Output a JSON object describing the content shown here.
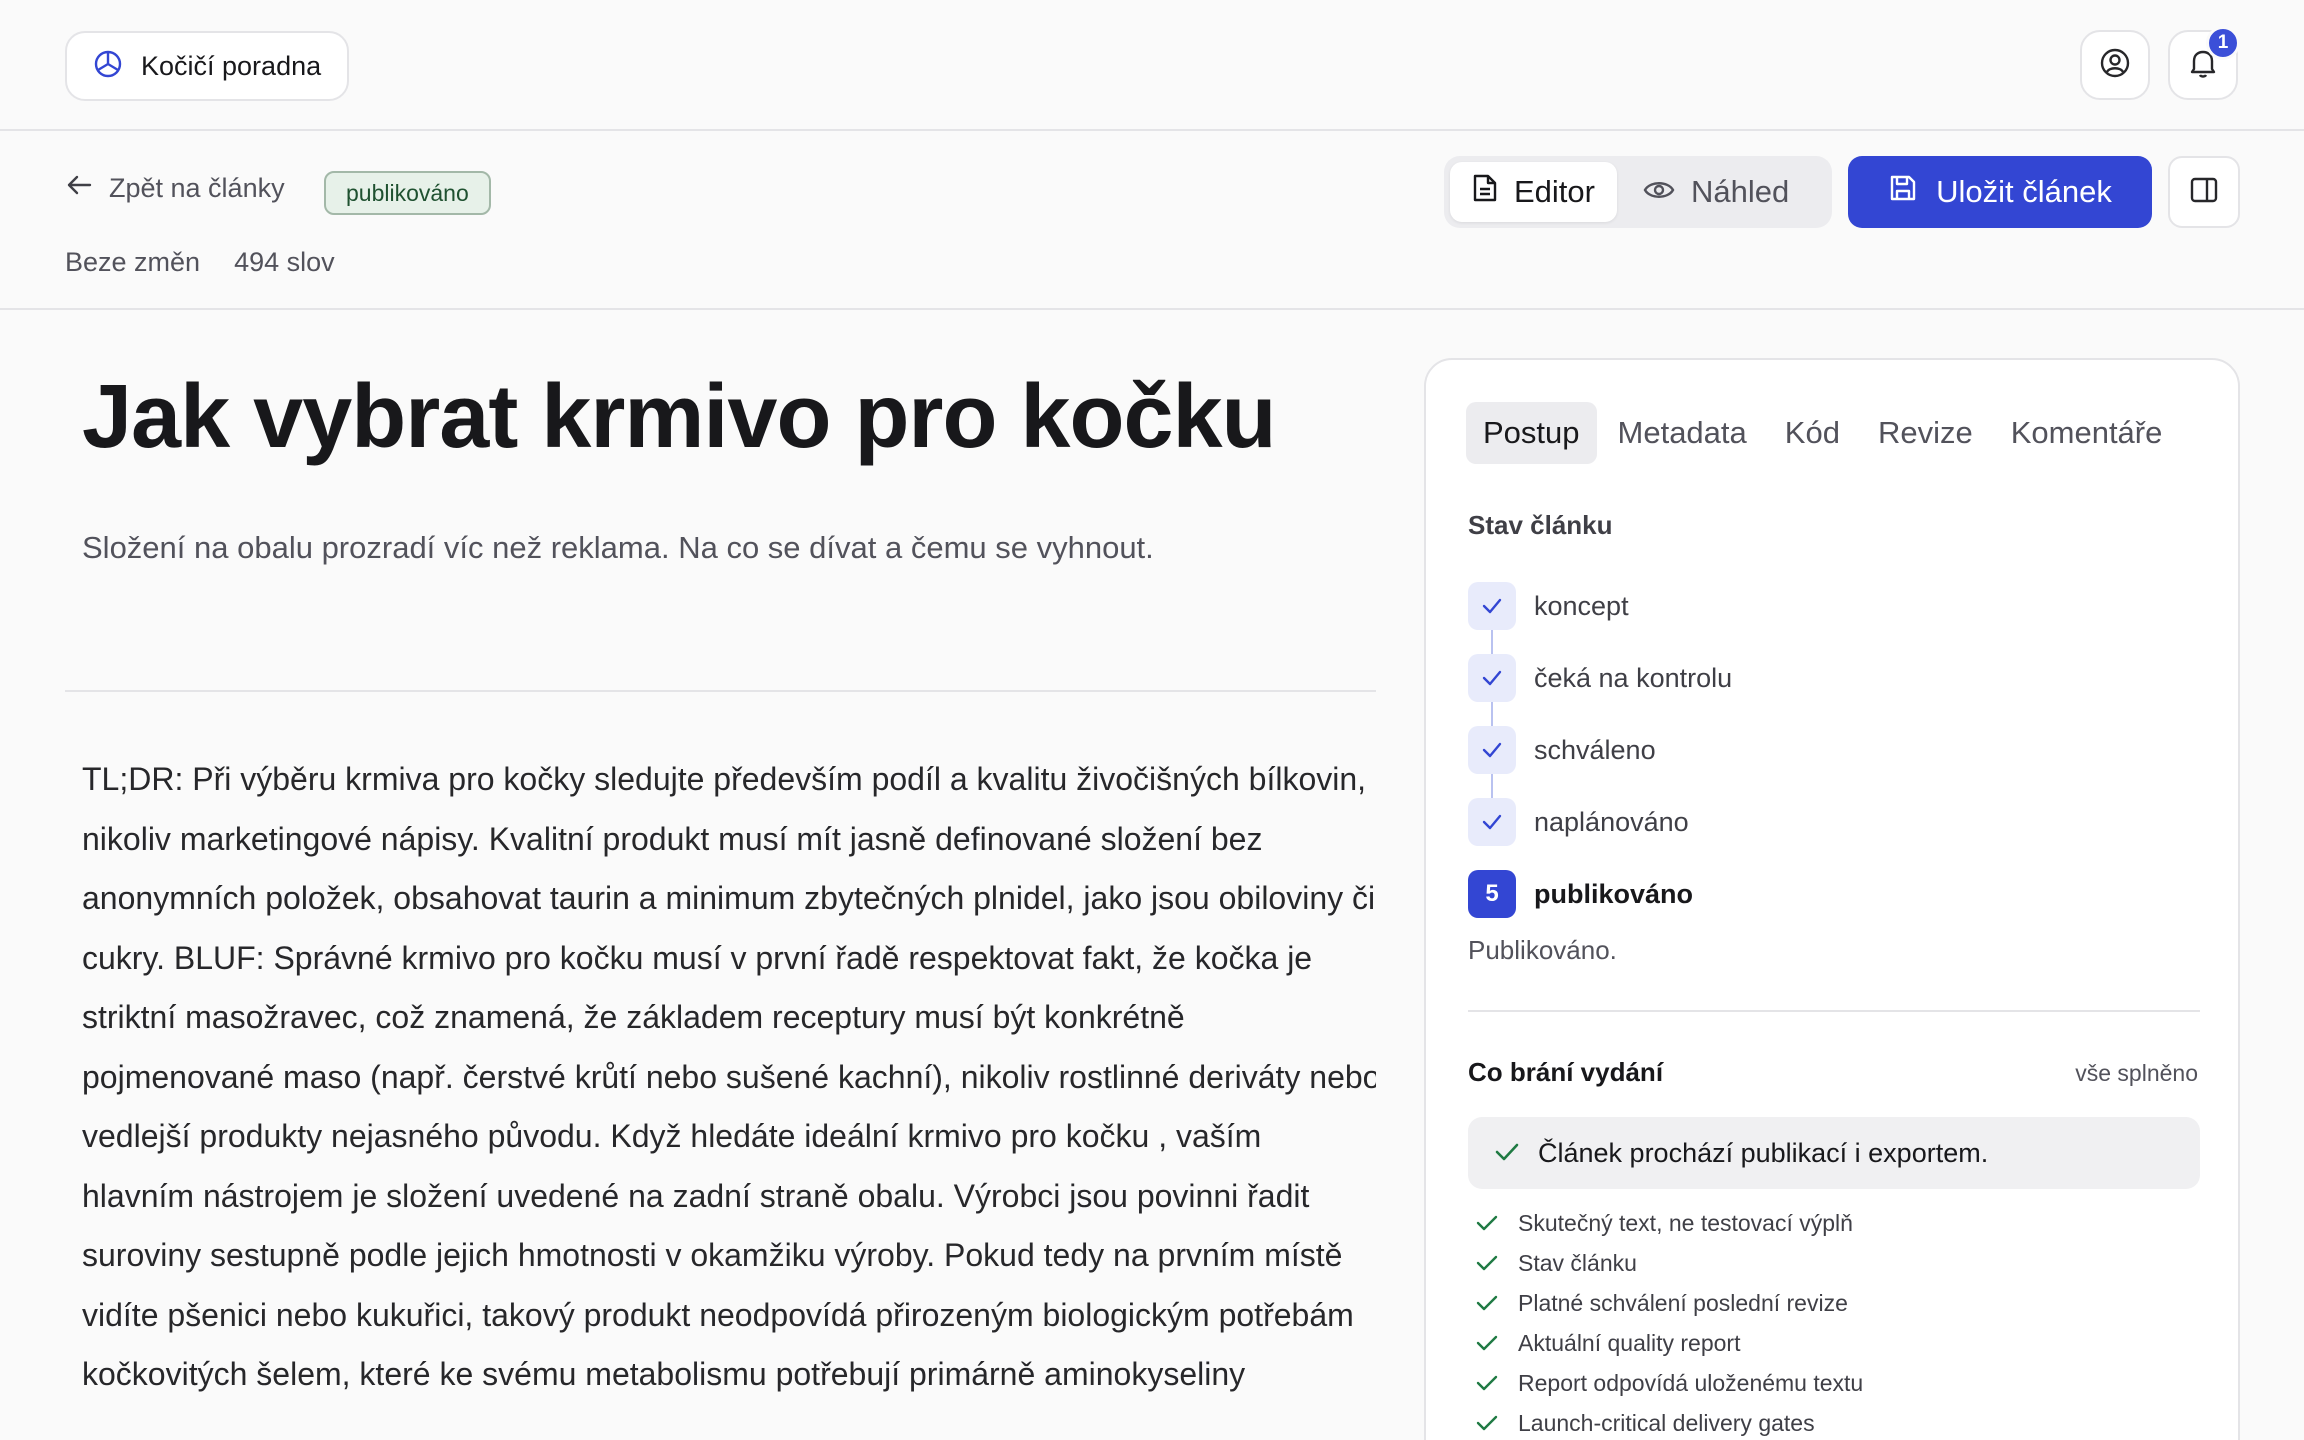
{
  "header": {
    "brand": "Kočičí poradna",
    "notifications_count": "1"
  },
  "toolbar": {
    "back_label": "Zpět na články",
    "status": "publikováno",
    "save_state": "Beze změn",
    "word_count": "494 slov",
    "editor_label": "Editor",
    "preview_label": "Náhled",
    "save_label": "Uložit článek"
  },
  "article": {
    "title": "Jak vybrat krmivo pro kočku",
    "lede": "Složení na obalu prozradí víc než reklama. Na co se dívat a čemu se vyhnout.",
    "body": "TL;DR: Při výběru krmiva pro kočky sledujte především podíl a kvalitu živočišných bílkovin, nikoliv marketingové nápisy. Kvalitní produkt musí mít jasně definované složení bez anonymních položek, obsahovat taurin a minimum zbytečných plnidel, jako jsou obiloviny či cukry. BLUF: Správné krmivo pro kočku musí v první řadě respektovat fakt, že kočka je striktní masožravec, což znamená, že základem receptury musí být konkrétně pojmenované maso (např. čerstvé krůtí nebo sušené kachní), nikoliv rostlinné deriváty nebo vedlejší produkty nejasného původu. Když hledáte ideální krmivo pro kočku , vaším hlavním nástrojem je složení uvedené na zadní straně obalu. Výrobci jsou povinni řadit suroviny sestupně podle jejich hmotnosti v okamžiku výroby. Pokud tedy na prvním místě vidíte pšenici nebo kukuřici, takový produkt neodpovídá přirozeným biologickým potřebám kočkovitých šelem, které ke svému metabolismu potřebují primárně aminokyseliny"
  },
  "panel": {
    "tabs": [
      {
        "label": "Postup"
      },
      {
        "label": "Metadata"
      },
      {
        "label": "Kód"
      },
      {
        "label": "Revize"
      },
      {
        "label": "Komentáře"
      }
    ],
    "status_title": "Stav článku",
    "steps": [
      {
        "label": "koncept"
      },
      {
        "label": "čeká na kontrolu"
      },
      {
        "label": "schváleno"
      },
      {
        "label": "naplánováno"
      },
      {
        "label": "publikováno",
        "number": "5"
      }
    ],
    "status_note": "Publikováno.",
    "blockers_title": "Co brání vydání",
    "blockers_summary": "vše splněno",
    "pass_message": "Článek prochází publikací i exportem.",
    "checks": [
      {
        "label": "Skutečný text, ne testovací výplň"
      },
      {
        "label": "Stav článku"
      },
      {
        "label": "Platné schválení poslední revize"
      },
      {
        "label": "Aktuální quality report"
      },
      {
        "label": "Report odpovídá uloženému textu"
      },
      {
        "label": "Launch-critical delivery gates"
      }
    ]
  },
  "colors": {
    "accent": "#3346d3",
    "status_bg": "#e7f1e9",
    "status_text": "#1f5130",
    "check": "#1f7a43"
  }
}
